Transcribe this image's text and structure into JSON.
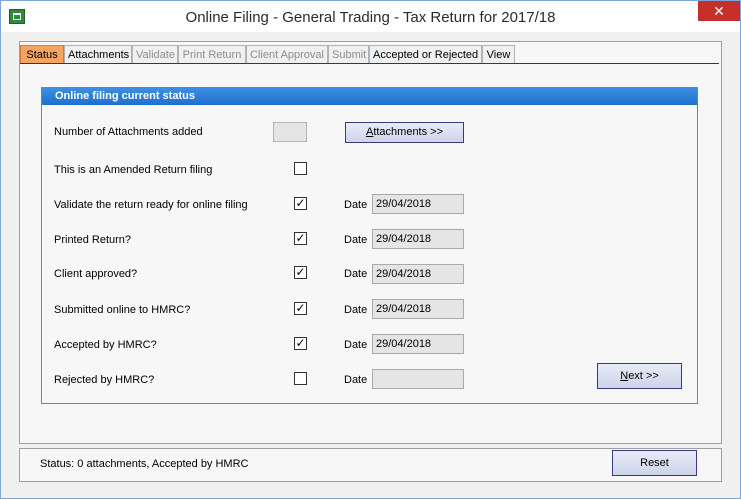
{
  "window": {
    "title": "Online Filing - General Trading - Tax Return for 2017/18",
    "close_glyph": "✕"
  },
  "tabs": [
    {
      "label": "Status",
      "state": "active"
    },
    {
      "label": "Attachments",
      "state": "enabled"
    },
    {
      "label": "Validate",
      "state": "disabled"
    },
    {
      "label": "Print Return",
      "state": "disabled"
    },
    {
      "label": "Client Approval",
      "state": "disabled"
    },
    {
      "label": "Submit",
      "state": "disabled"
    },
    {
      "label": "Accepted or Rejected",
      "state": "enabled"
    },
    {
      "label": "View",
      "state": "enabled"
    }
  ],
  "panel": {
    "title": "Online filing current status",
    "attachments_label": "Number of Attachments added",
    "attachments_count": "",
    "attachments_button_prefix": "A",
    "attachments_button_rest": "ttachments >>",
    "amended_label": "This is an Amended Return filing",
    "amended_checked": false,
    "date_label": "Date",
    "rows": [
      {
        "label": "Validate the return ready for online filing",
        "checked": true,
        "date": "29/04/2018"
      },
      {
        "label": "Printed Return?",
        "checked": true,
        "date": "29/04/2018"
      },
      {
        "label": "Client approved?",
        "checked": true,
        "date": "29/04/2018"
      },
      {
        "label": "Submitted online to HMRC?",
        "checked": true,
        "date": "29/04/2018"
      },
      {
        "label": "Accepted by HMRC?",
        "checked": true,
        "date": "29/04/2018"
      },
      {
        "label": "Rejected by HMRC?",
        "checked": false,
        "date": ""
      }
    ],
    "next_button_prefix": "N",
    "next_button_rest": "ext >>"
  },
  "status": {
    "text": "Status: 0 attachments, Accepted by HMRC",
    "reset_label": "Reset"
  },
  "colors": {
    "active_tab": "#f4a460",
    "group_header": "#1e6fd0",
    "close_button": "#c7302a"
  },
  "icons": {
    "app": "app-icon",
    "close": "close-icon",
    "check": "checkmark-icon"
  }
}
